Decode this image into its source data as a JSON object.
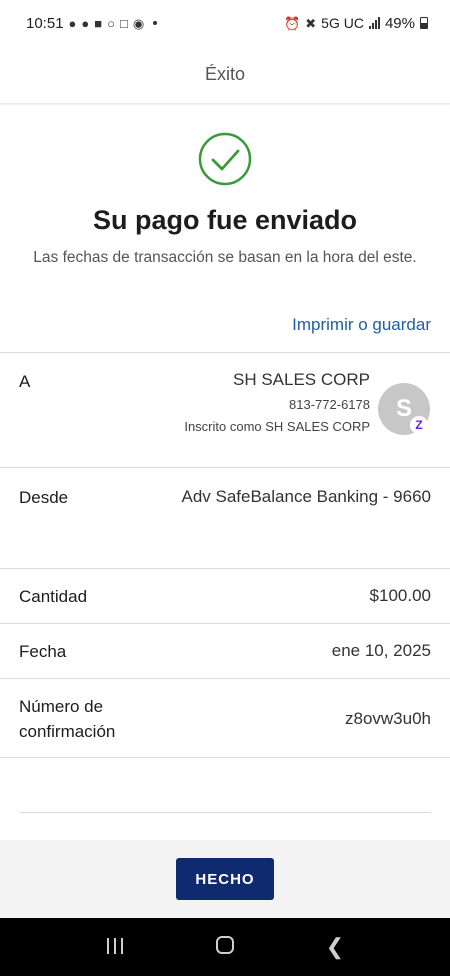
{
  "status_bar": {
    "time": "10:51",
    "network": "5G UC",
    "battery": "49%",
    "left_icons": [
      "snapchat-icon",
      "snapchat-icon",
      "messages-icon",
      "whatsapp-icon",
      "instagram-icon",
      "facebook-icon"
    ],
    "right_icons": [
      "alarm-icon",
      "mute-icon",
      "signal-icon",
      "battery-icon"
    ]
  },
  "header": {
    "title": "Éxito"
  },
  "success": {
    "icon": "check-circle-icon",
    "icon_color": "#3a9a3a",
    "title": "Su pago fue enviado",
    "subtitle": "Las fechas de transacción se basan en la hora del este."
  },
  "print_link": "Imprimir o guardar",
  "details": {
    "to": {
      "label": "A",
      "name": "SH SALES CORP",
      "phone": "813-772-6178",
      "enrolled": "Inscrito como SH SALES CORP",
      "avatar_initial": "S",
      "badge": "Z"
    },
    "from": {
      "label": "Desde",
      "value": "Adv SafeBalance Banking - 9660"
    },
    "amount": {
      "label": "Cantidad",
      "value": "$100.00"
    },
    "date": {
      "label": "Fecha",
      "value": "ene 10, 2025"
    },
    "confirmation": {
      "label": "Número de confirmación",
      "value": "z8ovw3u0h"
    }
  },
  "done_button": "HECHO",
  "colors": {
    "primary": "#0f2a6e",
    "link": "#1f5f9e",
    "success": "#3a9a3a"
  }
}
